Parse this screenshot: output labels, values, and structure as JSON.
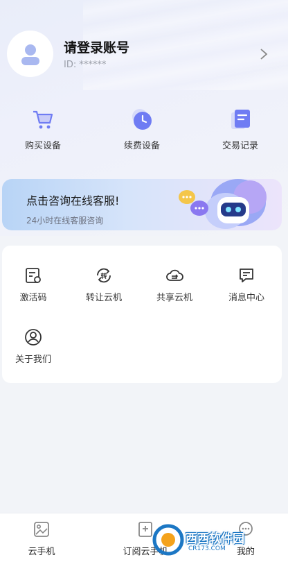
{
  "profile": {
    "title": "请登录账号",
    "id_label": "ID: ******"
  },
  "quick_actions": [
    {
      "label": "购买设备",
      "icon": "cart-icon"
    },
    {
      "label": "续费设备",
      "icon": "clock-icon"
    },
    {
      "label": "交易记录",
      "icon": "document-icon"
    }
  ],
  "banner": {
    "title": "点击咨询在线客服!",
    "subtitle": "24小时在线客服咨询",
    "icon": "robot-mascot-icon"
  },
  "menu": [
    {
      "label": "激活码",
      "icon": "activation-code-icon"
    },
    {
      "label": "转让云机",
      "icon": "transfer-icon"
    },
    {
      "label": "共享云机",
      "icon": "cloud-share-icon"
    },
    {
      "label": "消息中心",
      "icon": "message-icon"
    },
    {
      "label": "关于我们",
      "icon": "user-circle-icon"
    }
  ],
  "tabs": [
    {
      "label": "云手机",
      "icon": "image-icon"
    },
    {
      "label": "订阅云手机",
      "icon": "subscribe-icon"
    },
    {
      "label": "我的",
      "icon": "chat-icon"
    }
  ],
  "watermark": {
    "text": "西西软件园",
    "sub": "CR173.COM"
  },
  "colors": {
    "accent": "#4a6cf7",
    "icon_purple": "#6f7cf3",
    "banner_start": "#b8d4f6",
    "banner_end": "#ece4fb"
  }
}
